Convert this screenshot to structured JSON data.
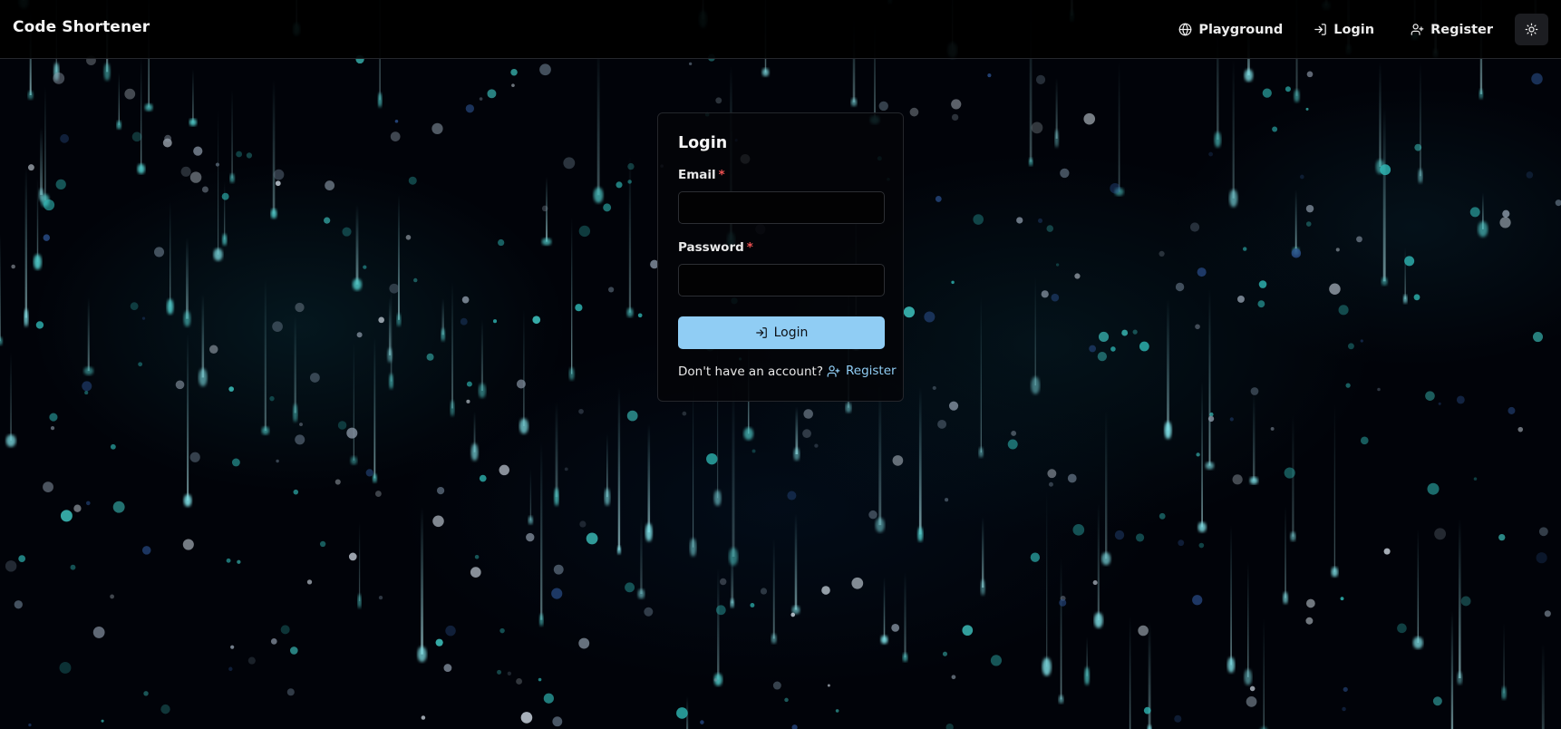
{
  "colors": {
    "background": "#010309",
    "accent": "#90cdf4",
    "required": "#f05252",
    "particle": "#2fb7b4"
  },
  "header": {
    "brand": "Code Shortener",
    "nav": {
      "playground": {
        "label": "Playground",
        "icon": "globe-icon"
      },
      "login": {
        "label": "Login",
        "icon": "log-in-icon"
      },
      "register": {
        "label": "Register",
        "icon": "user-plus-icon"
      }
    },
    "theme_toggle": {
      "icon": "sun-icon"
    }
  },
  "login_form": {
    "title": "Login",
    "email": {
      "label": "Email",
      "required_mark": "*",
      "value": "",
      "placeholder": ""
    },
    "password": {
      "label": "Password",
      "required_mark": "*",
      "value": "",
      "placeholder": ""
    },
    "submit": {
      "label": "Login",
      "icon": "log-in-icon"
    },
    "footer": {
      "prompt": "Don't have an account?",
      "register_label": "Register",
      "register_icon": "user-plus-icon"
    }
  }
}
